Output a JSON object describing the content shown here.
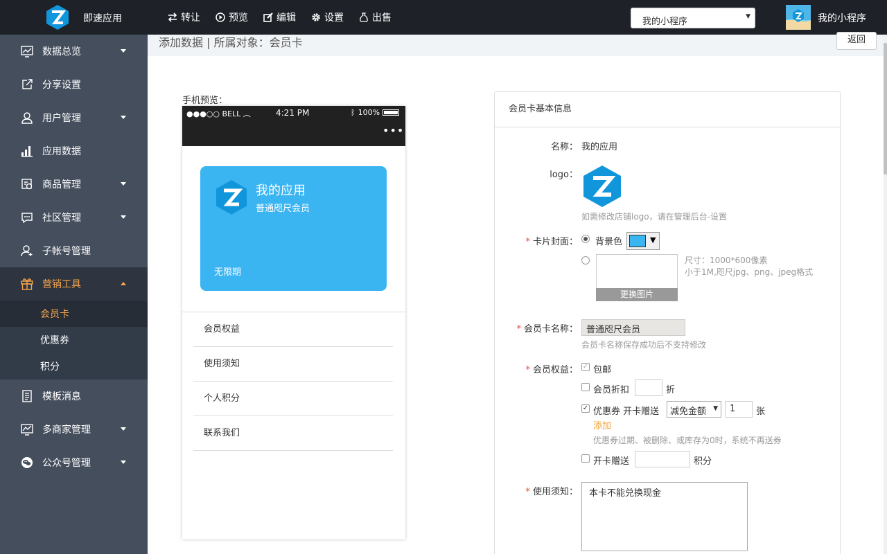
{
  "topbar": {
    "brand_name": "即速应用",
    "actions": [
      {
        "icon": "transfer-icon",
        "label": "转让"
      },
      {
        "icon": "preview-icon",
        "label": "预览"
      },
      {
        "icon": "edit-icon",
        "label": "编辑"
      },
      {
        "icon": "gear-icon",
        "label": "设置"
      },
      {
        "icon": "moneybag-icon",
        "label": "出售"
      }
    ],
    "miniprogram_select": "我的小程序",
    "user_name": "我的小程序"
  },
  "sidebar": {
    "items": [
      {
        "icon": "chart-icon",
        "label": "数据总览",
        "has_submenu": true
      },
      {
        "icon": "share-icon",
        "label": "分享设置",
        "has_submenu": false
      },
      {
        "icon": "user-icon",
        "label": "用户管理",
        "has_submenu": true
      },
      {
        "icon": "bar-chart-icon",
        "label": "应用数据",
        "has_submenu": false
      },
      {
        "icon": "goods-icon",
        "label": "商品管理",
        "has_submenu": true
      },
      {
        "icon": "community-icon",
        "label": "社区管理",
        "has_submenu": true
      },
      {
        "icon": "add-user-icon",
        "label": "子帐号管理",
        "has_submenu": false
      },
      {
        "icon": "gift-icon",
        "label": "营销工具",
        "has_submenu": true,
        "active": true
      }
    ],
    "marketing_sub": [
      {
        "label": "会员卡",
        "active": true
      },
      {
        "label": "优惠券",
        "active": false
      },
      {
        "label": "积分",
        "active": false
      }
    ],
    "items_after": [
      {
        "icon": "template-icon",
        "label": "模板消息",
        "has_submenu": false
      },
      {
        "icon": "merchant-icon",
        "label": "多商家管理",
        "has_submenu": true
      },
      {
        "icon": "wechat-icon",
        "label": "公众号管理",
        "has_submenu": true
      }
    ]
  },
  "header": {
    "title": "添加数据 | 所属对象：会员卡",
    "back_label": "返回"
  },
  "preview": {
    "label": "手机预览：",
    "carrier": "●●●○○ BELL",
    "time": "4:21 PM",
    "battery": "100%",
    "more": "•••",
    "card": {
      "app_name": "我的应用",
      "level": "普通咫尺会员",
      "validity": "无限期",
      "color": "#3bb4f2"
    },
    "menu": [
      "会员权益",
      "使用须知",
      "个人积分",
      "联系我们"
    ]
  },
  "form": {
    "panel_title": "会员卡基本信息",
    "name_label": "名称：",
    "name_value": "我的应用",
    "logo_label": "logo：",
    "logo_hint": "如需修改店铺logo，请在管理后台-设置",
    "cover_label": "卡片封面：",
    "cover_bg_label": "背景色",
    "cover_color": "#3bb4f2",
    "cover_size_hint": "尺寸：1000*600像素",
    "cover_format_hint": "小于1M,咫尺jpg、png、jpeg格式",
    "change_image_label": "更换图片",
    "card_name_label": "会员卡名称：",
    "card_name_value": "普通咫尺会员",
    "card_name_hint": "会员卡名称保存成功后不支持修改",
    "benefits_label": "会员权益：",
    "free_shipping": "包邮",
    "discount_label": "会员折扣",
    "discount_unit": "折",
    "coupon_label": "优惠券 开卡赠送",
    "coupon_type": "减免金额",
    "coupon_count": "1",
    "coupon_unit": "张",
    "add_label": "添加",
    "coupon_hint": "优惠券过期、被删除、或库存为0时，系统不再送券",
    "points_label": "开卡赠送",
    "points_unit": "积分",
    "notice_label": "使用须知：",
    "notice_value": "本卡不能兑换现金"
  }
}
